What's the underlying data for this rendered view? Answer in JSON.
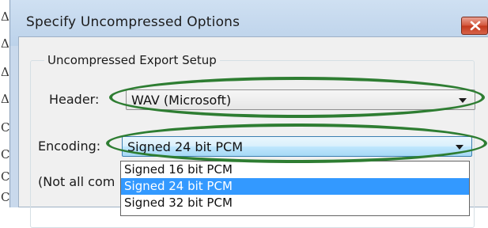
{
  "window": {
    "title": "Specify Uncompressed Options"
  },
  "left_margin_glyphs": [
    "Δ",
    "Δ",
    "Δ",
    "Δ",
    "C",
    "C",
    "C",
    "C"
  ],
  "group": {
    "title": "Uncompressed Export Setup"
  },
  "header_field": {
    "label": "Header:",
    "value": "WAV (Microsoft)"
  },
  "encoding_field": {
    "label": "Encoding:",
    "value": "Signed 24 bit PCM"
  },
  "encoding_options": [
    "Signed 16 bit PCM",
    "Signed 24 bit PCM",
    "Signed 32 bit PCM"
  ],
  "note_partial": "(Not all com",
  "colors": {
    "highlight_ring": "#2e7d32",
    "selection": "#3399ff",
    "close_button": "#c3381c"
  }
}
